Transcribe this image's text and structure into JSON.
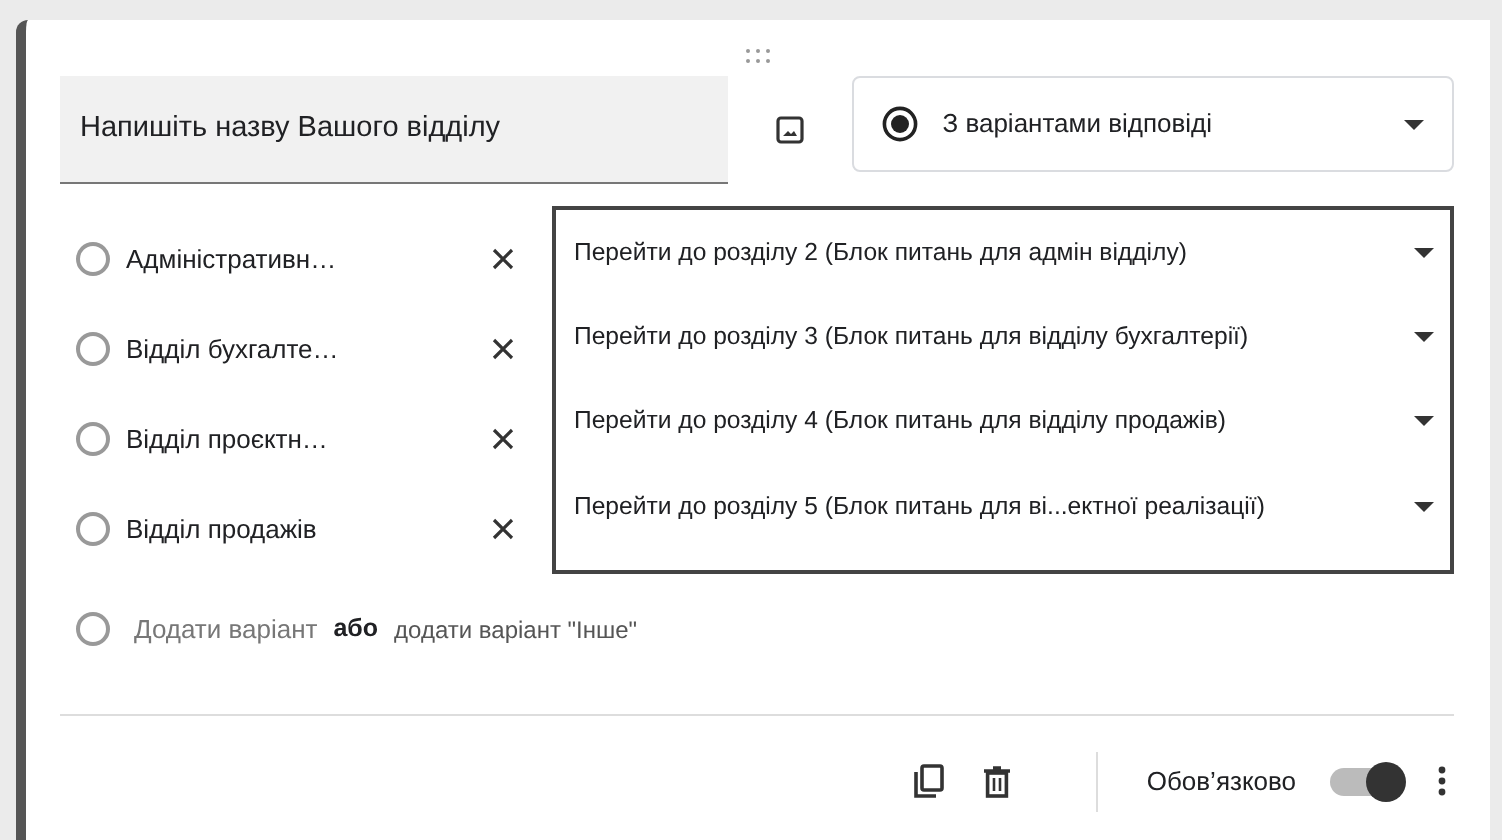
{
  "question": {
    "title": "Напишіть назву Вашого відділу",
    "type": {
      "label": "З варіантами відповіді"
    }
  },
  "options": [
    {
      "label": "Адміністративн…",
      "selected": false,
      "go_to": "Перейти до розділу 2 (Блок питань для адмін відділу)"
    },
    {
      "label": "Відділ бухгалте…",
      "selected": false,
      "go_to": "Перейти до розділу 3 (Блок питань для відділу бухгалтерії)"
    },
    {
      "label": "Відділ проєктн…",
      "selected": false,
      "go_to": "Перейти до розділу 4 (Блок питань для відділу продажів)"
    },
    {
      "label": "Відділ продажів",
      "selected": false,
      "go_to": "Перейти до розділу 5 (Блок питань для ві...ектної реалізації)"
    }
  ],
  "add_option": {
    "selected": false,
    "text": "Додати варіант",
    "or": "або",
    "other": "додати варіант \"Інше\""
  },
  "footer": {
    "required_label": "Обов’язково",
    "required": true
  }
}
